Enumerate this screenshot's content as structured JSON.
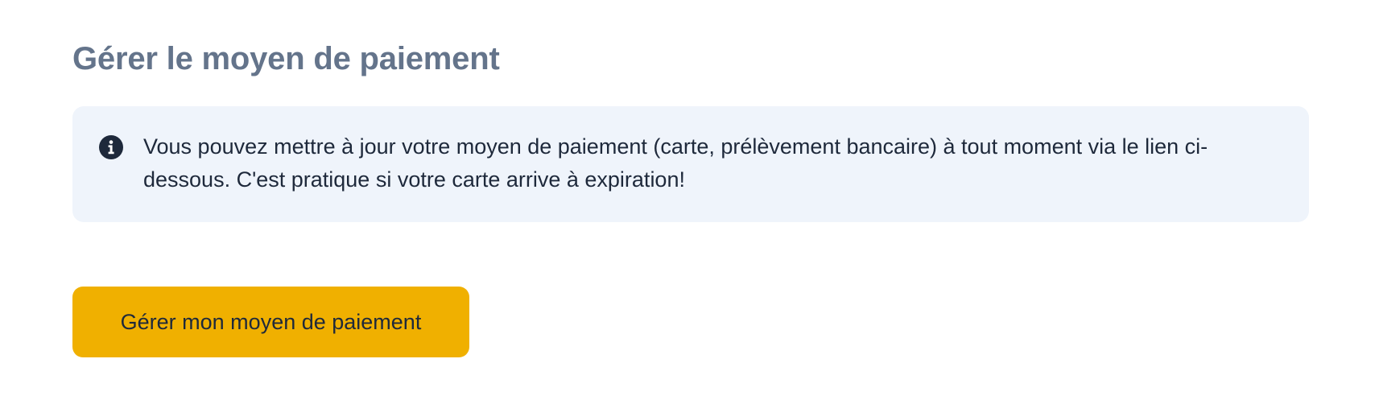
{
  "page": {
    "title": "Gérer le moyen de paiement"
  },
  "info_box": {
    "icon": "info-icon",
    "text": "Vous pouvez mettre à jour votre moyen de paiement (carte, prélèvement bancaire) à tout moment via le lien ci-dessous. C'est pratique si votre carte arrive à expiration!"
  },
  "actions": {
    "manage_payment_label": "Gérer mon moyen de paiement"
  },
  "colors": {
    "title": "#64748b",
    "info_background": "#eff4fb",
    "text": "#1e293b",
    "button_accent": "#f0b000"
  }
}
